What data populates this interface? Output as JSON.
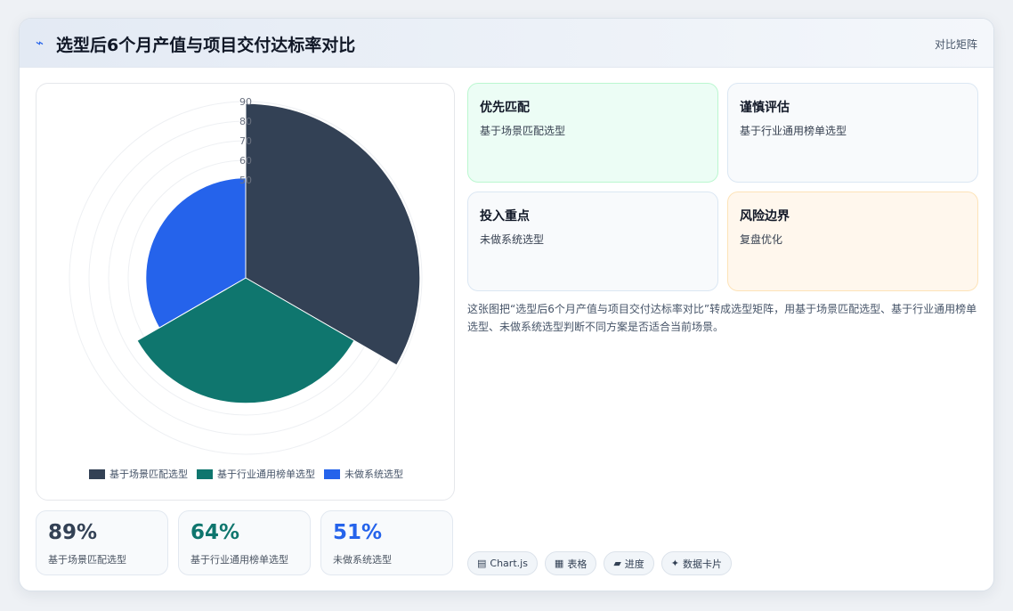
{
  "header": {
    "icon": "pulse-icon",
    "title": "选型后6个月产值与项目交付达标率对比",
    "link_label": "对比矩阵"
  },
  "chart_data": {
    "type": "polarArea",
    "categories": [
      "基于场景匹配选型",
      "基于行业通用榜单选型",
      "未做系统选型"
    ],
    "values": [
      89,
      64,
      51
    ],
    "colors": [
      "#334155",
      "#0f766e",
      "#2563eb"
    ],
    "r_axis_ticks": [
      "50",
      "60",
      "70",
      "80",
      "90"
    ],
    "r_max": 90,
    "grid": true,
    "legend_position": "bottom"
  },
  "stats": [
    {
      "value": "89%",
      "label": "基于场景匹配选型",
      "color": "#334155"
    },
    {
      "value": "64%",
      "label": "基于行业通用榜单选型",
      "color": "#0f766e"
    },
    {
      "value": "51%",
      "label": "未做系统选型",
      "color": "#2563eb"
    }
  ],
  "quadrants": [
    {
      "title": "优先匹配",
      "subtitle": "基于场景匹配选型",
      "bg": "#ecfdf5",
      "border": "#bbf7d0"
    },
    {
      "title": "谨慎评估",
      "subtitle": "基于行业通用榜单选型",
      "bg": "#f8fafc",
      "border": "#dbe7f3"
    },
    {
      "title": "投入重点",
      "subtitle": "未做系统选型",
      "bg": "#f8fafc",
      "border": "#dbe7f3"
    },
    {
      "title": "风险边界",
      "subtitle": "复盘优化",
      "bg": "#fff7ed",
      "border": "#fde3b8"
    }
  ],
  "description": "这张图把“选型后6个月产值与项目交付达标率对比”转成选型矩阵，用基于场景匹配选型、基于行业通用榜单选型、未做系统选型判断不同方案是否适合当前场景。",
  "tags": [
    {
      "icon": "chart-icon",
      "glyph": "▤",
      "label": "Chart.js"
    },
    {
      "icon": "table-icon",
      "glyph": "▦",
      "label": "表格"
    },
    {
      "icon": "progress-icon",
      "glyph": "▰",
      "label": "进度"
    },
    {
      "icon": "sparkle-icon",
      "glyph": "✦",
      "label": "数据卡片"
    }
  ]
}
